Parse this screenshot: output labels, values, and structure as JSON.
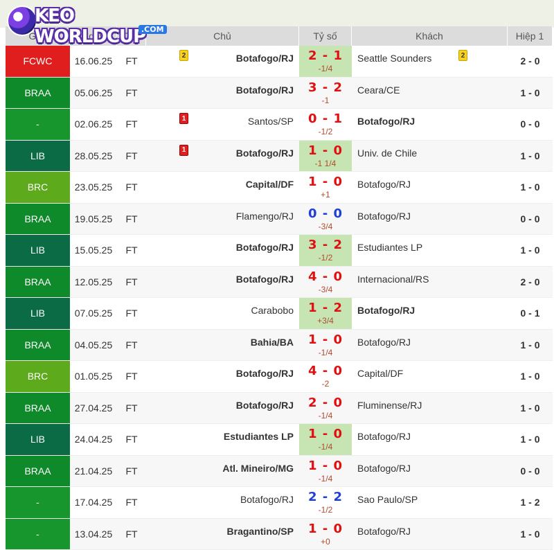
{
  "logo": {
    "main": "KEO WORLDCUP",
    "sub": ".COM"
  },
  "header": {
    "league": "Giải",
    "date": "Ngày",
    "status": "TT",
    "home": "Chủ",
    "score": "Tỷ số",
    "away": "Khách",
    "ht": "Hiệp 1"
  },
  "colors": {
    "win": "#c6e5b3",
    "FCWC": "#e01e1e",
    "BRAA": "#0f8a2a",
    "-": "#17962e",
    "LIB": "#0a6b45",
    "BRC": "#5daa1c",
    "score_red": "#e01010",
    "score_blue": "#1f3fd8"
  },
  "matches": [
    {
      "league": "FCWC",
      "date": "16.06.25",
      "status": "FT",
      "home": "Botafogo/RJ",
      "score": "2 - 1",
      "hc": "-1/4",
      "away": "Seattle Sounders",
      "ht": "2 - 0",
      "win": true,
      "home_bold": true,
      "away_bold": false,
      "score_color": "red",
      "home_card": "2",
      "home_card_type": "yellow",
      "away_card": "2",
      "away_card_type": "yellow"
    },
    {
      "league": "BRAA",
      "date": "05.06.25",
      "status": "FT",
      "home": "Botafogo/RJ",
      "score": "3 - 2",
      "hc": "-1",
      "away": "Ceara/CE",
      "ht": "1 - 0",
      "win": false,
      "home_bold": true,
      "away_bold": false,
      "score_color": "red"
    },
    {
      "league": "-",
      "date": "02.06.25",
      "status": "FT",
      "home": "Santos/SP",
      "score": "0 - 1",
      "hc": "-1/2",
      "away": "Botafogo/RJ",
      "ht": "0 - 0",
      "win": false,
      "home_bold": false,
      "away_bold": true,
      "score_color": "red",
      "home_card": "1",
      "home_card_type": "red"
    },
    {
      "league": "LIB",
      "date": "28.05.25",
      "status": "FT",
      "home": "Botafogo/RJ",
      "score": "1 - 0",
      "hc": "-1 1/4",
      "away": "Univ. de Chile",
      "ht": "1 - 0",
      "win": true,
      "home_bold": true,
      "away_bold": false,
      "score_color": "red",
      "home_card": "1",
      "home_card_type": "red"
    },
    {
      "league": "BRC",
      "date": "23.05.25",
      "status": "FT",
      "home": "Capital/DF",
      "score": "1 - 0",
      "hc": "+1",
      "away": "Botafogo/RJ",
      "ht": "1 - 0",
      "win": false,
      "home_bold": true,
      "away_bold": false,
      "score_color": "red"
    },
    {
      "league": "BRAA",
      "date": "19.05.25",
      "status": "FT",
      "home": "Flamengo/RJ",
      "score": "0 - 0",
      "hc": "-3/4",
      "away": "Botafogo/RJ",
      "ht": "0 - 0",
      "win": false,
      "home_bold": false,
      "away_bold": false,
      "score_color": "blue"
    },
    {
      "league": "LIB",
      "date": "15.05.25",
      "status": "FT",
      "home": "Botafogo/RJ",
      "score": "3 - 2",
      "hc": "-1/2",
      "away": "Estudiantes LP",
      "ht": "1 - 0",
      "win": true,
      "home_bold": true,
      "away_bold": false,
      "score_color": "red"
    },
    {
      "league": "BRAA",
      "date": "12.05.25",
      "status": "FT",
      "home": "Botafogo/RJ",
      "score": "4 - 0",
      "hc": "-3/4",
      "away": "Internacional/RS",
      "ht": "2 - 0",
      "win": false,
      "home_bold": true,
      "away_bold": false,
      "score_color": "red"
    },
    {
      "league": "LIB",
      "date": "07.05.25",
      "status": "FT",
      "home": "Carabobo",
      "score": "1 - 2",
      "hc": "+3/4",
      "away": "Botafogo/RJ",
      "ht": "0 - 1",
      "win": true,
      "home_bold": false,
      "away_bold": true,
      "score_color": "red"
    },
    {
      "league": "BRAA",
      "date": "04.05.25",
      "status": "FT",
      "home": "Bahia/BA",
      "score": "1 - 0",
      "hc": "-1/4",
      "away": "Botafogo/RJ",
      "ht": "1 - 0",
      "win": false,
      "home_bold": true,
      "away_bold": false,
      "score_color": "red"
    },
    {
      "league": "BRC",
      "date": "01.05.25",
      "status": "FT",
      "home": "Botafogo/RJ",
      "score": "4 - 0",
      "hc": "-2",
      "away": "Capital/DF",
      "ht": "1 - 0",
      "win": false,
      "home_bold": true,
      "away_bold": false,
      "score_color": "red"
    },
    {
      "league": "BRAA",
      "date": "27.04.25",
      "status": "FT",
      "home": "Botafogo/RJ",
      "score": "2 - 0",
      "hc": "-1/4",
      "away": "Fluminense/RJ",
      "ht": "1 - 0",
      "win": false,
      "home_bold": true,
      "away_bold": false,
      "score_color": "red"
    },
    {
      "league": "LIB",
      "date": "24.04.25",
      "status": "FT",
      "home": "Estudiantes LP",
      "score": "1 - 0",
      "hc": "-1/4",
      "away": "Botafogo/RJ",
      "ht": "1 - 0",
      "win": true,
      "home_bold": true,
      "away_bold": false,
      "score_color": "red"
    },
    {
      "league": "BRAA",
      "date": "21.04.25",
      "status": "FT",
      "home": "Atl. Mineiro/MG",
      "score": "1 - 0",
      "hc": "-1/4",
      "away": "Botafogo/RJ",
      "ht": "0 - 0",
      "win": false,
      "home_bold": true,
      "away_bold": false,
      "score_color": "red"
    },
    {
      "league": "-",
      "date": "17.04.25",
      "status": "FT",
      "home": "Botafogo/RJ",
      "score": "2 - 2",
      "hc": "-1/2",
      "away": "Sao Paulo/SP",
      "ht": "1 - 2",
      "win": false,
      "home_bold": false,
      "away_bold": false,
      "score_color": "blue"
    },
    {
      "league": "-",
      "date": "13.04.25",
      "status": "FT",
      "home": "Bragantino/SP",
      "score": "1 - 0",
      "hc": "+0",
      "away": "Botafogo/RJ",
      "ht": "1 - 0",
      "win": false,
      "home_bold": true,
      "away_bold": false,
      "score_color": "red"
    }
  ]
}
